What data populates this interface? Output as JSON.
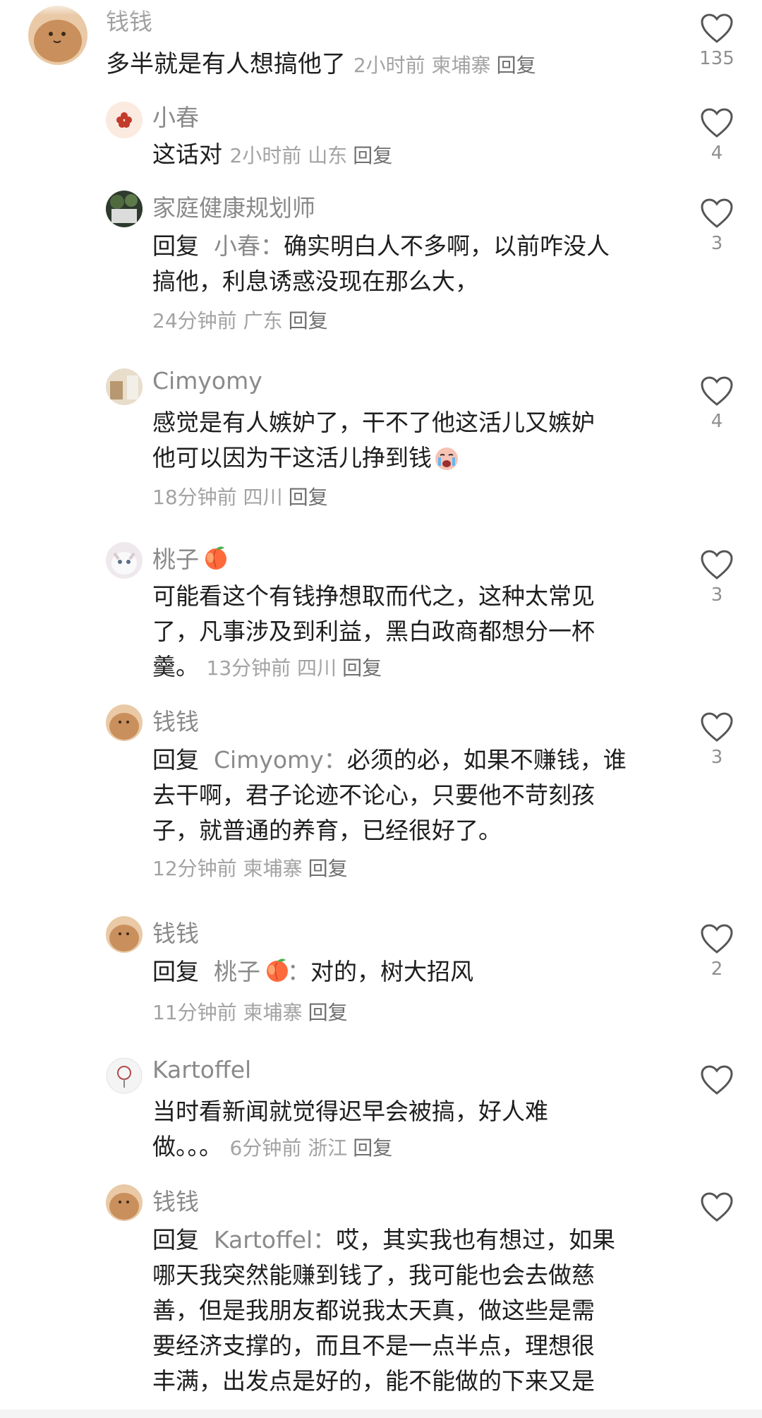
{
  "comments": [
    {
      "user": "钱钱",
      "text": "多半就是有人想搞他了",
      "time": "2小时前",
      "loc": "柬埔寨",
      "reply": "回复",
      "likes": "135"
    },
    {
      "user": "小春",
      "text": "这话对",
      "time": "2小时前",
      "loc": "山东",
      "reply": "回复",
      "likes": "4"
    },
    {
      "user": "家庭健康规划师",
      "reply_prefix": "回复",
      "reply_to": "小春：",
      "line1": "确实明白人不多啊，以前咋没人",
      "line2": "搞他，利息诱惑没现在那么大，",
      "time": "24分钟前",
      "loc": "广东",
      "reply": "回复",
      "likes": "3"
    },
    {
      "user": "Cimyomy",
      "line1": "感觉是有人嫉妒了，干不了他这活儿又嫉妒",
      "line2": "他可以因为干这活儿挣到钱",
      "time": "18分钟前",
      "loc": "四川",
      "reply": "回复",
      "likes": "4"
    },
    {
      "user": "桃子",
      "line1": "可能看这个有钱挣想取而代之，这种太常见",
      "line2": "了，凡事涉及到利益，黑白政商都想分一杯",
      "line3": "羹。",
      "time": "13分钟前",
      "loc": "四川",
      "reply": "回复",
      "likes": "3"
    },
    {
      "user": "钱钱",
      "reply_prefix": "回复",
      "reply_to": "Cimyomy：",
      "line1": "必须的必，如果不赚钱，谁",
      "line2": "去干啊，君子论迹不论心，只要他不苛刻孩",
      "line3": "子，就普通的养育，已经很好了。",
      "time": "12分钟前",
      "loc": "柬埔寨",
      "reply": "回复",
      "likes": "3"
    },
    {
      "user": "钱钱",
      "reply_prefix": "回复",
      "reply_to": "桃子",
      "reply_to_suffix": "：",
      "line1": "对的，树大招风",
      "time": "11分钟前",
      "loc": "柬埔寨",
      "reply": "回复",
      "likes": "2"
    },
    {
      "user": "Kartoffel",
      "line1": "当时看新闻就觉得迟早会被搞，好人难",
      "line2": "做。。。",
      "time": "6分钟前",
      "loc": "浙江",
      "reply": "回复",
      "likes": ""
    },
    {
      "user": "钱钱",
      "reply_prefix": "回复",
      "reply_to": "Kartoffel：",
      "line1": "哎，其实我也有想过，如果",
      "line2": "哪天我突然能赚到钱了，我可能也会去做慈",
      "line3": "善，但是我朋友都说我太天真，做这些是需",
      "line4": "要经济支撑的，而且不是一点半点，理想很",
      "line5": "丰满，出发点是好的，能不能做的下来又是",
      "likes": ""
    }
  ],
  "icons": {
    "like": "heart-outline-icon",
    "peach": "peach-emoji-icon",
    "cry": "crying-emoji-icon"
  }
}
